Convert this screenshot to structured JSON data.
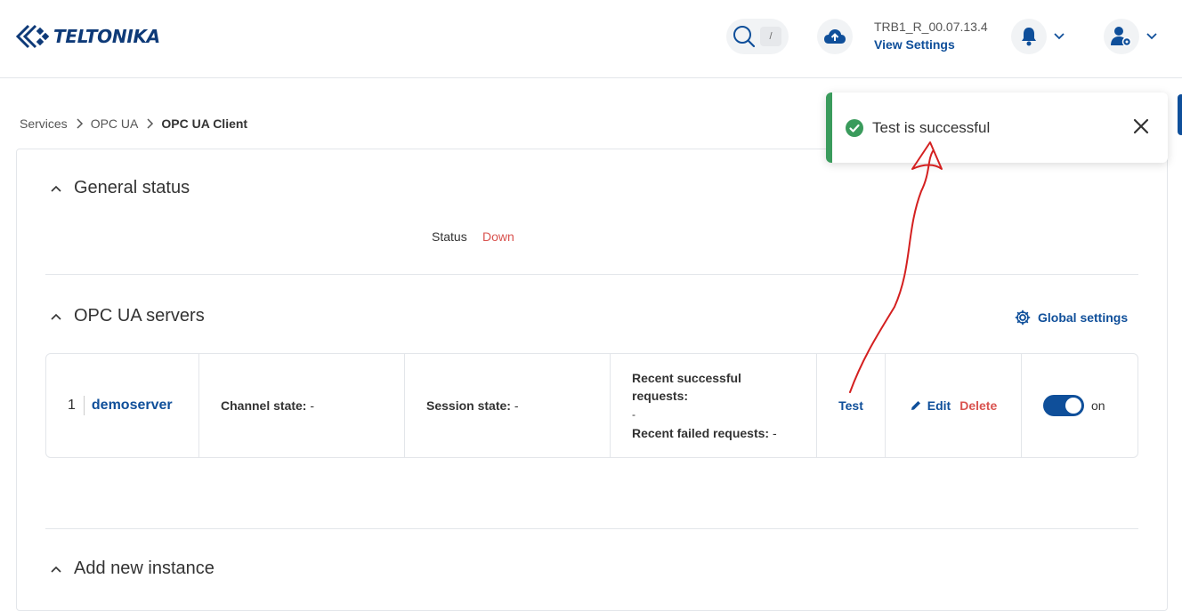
{
  "header": {
    "brand": "TELTONIKA",
    "search_key": "/",
    "firmware": "TRB1_R_00.07.13.4",
    "view_settings": "View Settings"
  },
  "breadcrumb": [
    "Services",
    "OPC UA",
    "OPC UA Client"
  ],
  "general_status": {
    "title": "General status",
    "status_label": "Status",
    "status_value": "Down"
  },
  "servers": {
    "title": "OPC UA servers",
    "global_settings": "Global settings",
    "rows": [
      {
        "index": "1",
        "name": "demoserver",
        "channel_state_label": "Channel state:",
        "channel_state_value": "-",
        "session_state_label": "Session state:",
        "session_state_value": "-",
        "recent_success_label": "Recent successful requests:",
        "recent_success_value": "-",
        "recent_failed_label": "Recent failed requests:",
        "recent_failed_value": "-",
        "test": "Test",
        "edit": "Edit",
        "delete": "Delete",
        "toggle_label": "on",
        "enabled": true
      }
    ]
  },
  "add_instance": {
    "title": "Add new instance"
  },
  "toast": {
    "message": "Test is successful"
  },
  "colors": {
    "primary": "#0f4f9a",
    "danger": "#d9534f",
    "success": "#3a9b5c",
    "annotation": "#d42020"
  }
}
